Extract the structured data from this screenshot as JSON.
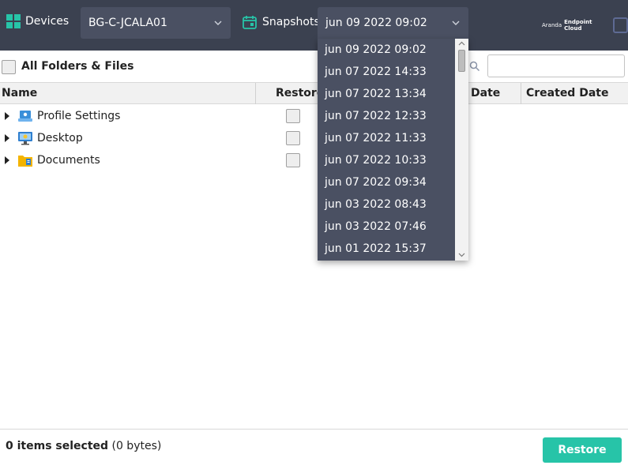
{
  "header": {
    "devices_label": "Devices",
    "device_selected": "BG-C-JCALA01",
    "snapshots_label": "Snapshots",
    "snapshot_selected": "jun 09 2022 09:02",
    "brand_light": "Aranda",
    "brand_bold": "Endpoint Cloud"
  },
  "toolbar": {
    "all_label": "All Folders & Files",
    "search_placeholder": ""
  },
  "table": {
    "headers": {
      "name": "Name",
      "restore": "Restore",
      "date": "Date",
      "created": "Created Date"
    },
    "rows": [
      {
        "label": "Profile Settings",
        "icon": "profile-settings-icon"
      },
      {
        "label": "Desktop",
        "icon": "desktop-icon"
      },
      {
        "label": "Documents",
        "icon": "documents-folder-icon"
      }
    ]
  },
  "snapshot_options": [
    "jun 09 2022 09:02",
    "jun 07 2022 14:33",
    "jun 07 2022 13:34",
    "jun 07 2022 12:33",
    "jun 07 2022 11:33",
    "jun 07 2022 10:33",
    "jun 07 2022 09:34",
    "jun 03 2022 08:43",
    "jun 03 2022 07:46",
    "jun 01 2022 15:37"
  ],
  "footer": {
    "selected_count": "0 items selected",
    "selected_size": "(0 bytes)",
    "restore_label": "Restore"
  },
  "colors": {
    "header_bg": "#3b4150",
    "accent": "#27c4a8",
    "dropdown_bg": "#4a5062"
  }
}
